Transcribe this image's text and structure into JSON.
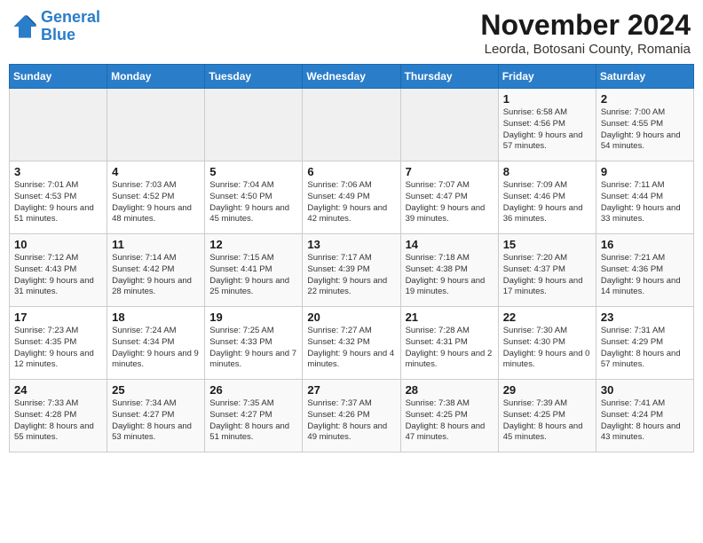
{
  "header": {
    "logo_line1": "General",
    "logo_line2": "Blue",
    "month_title": "November 2024",
    "location": "Leorda, Botosani County, Romania"
  },
  "days_of_week": [
    "Sunday",
    "Monday",
    "Tuesday",
    "Wednesday",
    "Thursday",
    "Friday",
    "Saturday"
  ],
  "weeks": [
    [
      {
        "day": "",
        "info": ""
      },
      {
        "day": "",
        "info": ""
      },
      {
        "day": "",
        "info": ""
      },
      {
        "day": "",
        "info": ""
      },
      {
        "day": "",
        "info": ""
      },
      {
        "day": "1",
        "info": "Sunrise: 6:58 AM\nSunset: 4:56 PM\nDaylight: 9 hours and 57 minutes."
      },
      {
        "day": "2",
        "info": "Sunrise: 7:00 AM\nSunset: 4:55 PM\nDaylight: 9 hours and 54 minutes."
      }
    ],
    [
      {
        "day": "3",
        "info": "Sunrise: 7:01 AM\nSunset: 4:53 PM\nDaylight: 9 hours and 51 minutes."
      },
      {
        "day": "4",
        "info": "Sunrise: 7:03 AM\nSunset: 4:52 PM\nDaylight: 9 hours and 48 minutes."
      },
      {
        "day": "5",
        "info": "Sunrise: 7:04 AM\nSunset: 4:50 PM\nDaylight: 9 hours and 45 minutes."
      },
      {
        "day": "6",
        "info": "Sunrise: 7:06 AM\nSunset: 4:49 PM\nDaylight: 9 hours and 42 minutes."
      },
      {
        "day": "7",
        "info": "Sunrise: 7:07 AM\nSunset: 4:47 PM\nDaylight: 9 hours and 39 minutes."
      },
      {
        "day": "8",
        "info": "Sunrise: 7:09 AM\nSunset: 4:46 PM\nDaylight: 9 hours and 36 minutes."
      },
      {
        "day": "9",
        "info": "Sunrise: 7:11 AM\nSunset: 4:44 PM\nDaylight: 9 hours and 33 minutes."
      }
    ],
    [
      {
        "day": "10",
        "info": "Sunrise: 7:12 AM\nSunset: 4:43 PM\nDaylight: 9 hours and 31 minutes."
      },
      {
        "day": "11",
        "info": "Sunrise: 7:14 AM\nSunset: 4:42 PM\nDaylight: 9 hours and 28 minutes."
      },
      {
        "day": "12",
        "info": "Sunrise: 7:15 AM\nSunset: 4:41 PM\nDaylight: 9 hours and 25 minutes."
      },
      {
        "day": "13",
        "info": "Sunrise: 7:17 AM\nSunset: 4:39 PM\nDaylight: 9 hours and 22 minutes."
      },
      {
        "day": "14",
        "info": "Sunrise: 7:18 AM\nSunset: 4:38 PM\nDaylight: 9 hours and 19 minutes."
      },
      {
        "day": "15",
        "info": "Sunrise: 7:20 AM\nSunset: 4:37 PM\nDaylight: 9 hours and 17 minutes."
      },
      {
        "day": "16",
        "info": "Sunrise: 7:21 AM\nSunset: 4:36 PM\nDaylight: 9 hours and 14 minutes."
      }
    ],
    [
      {
        "day": "17",
        "info": "Sunrise: 7:23 AM\nSunset: 4:35 PM\nDaylight: 9 hours and 12 minutes."
      },
      {
        "day": "18",
        "info": "Sunrise: 7:24 AM\nSunset: 4:34 PM\nDaylight: 9 hours and 9 minutes."
      },
      {
        "day": "19",
        "info": "Sunrise: 7:25 AM\nSunset: 4:33 PM\nDaylight: 9 hours and 7 minutes."
      },
      {
        "day": "20",
        "info": "Sunrise: 7:27 AM\nSunset: 4:32 PM\nDaylight: 9 hours and 4 minutes."
      },
      {
        "day": "21",
        "info": "Sunrise: 7:28 AM\nSunset: 4:31 PM\nDaylight: 9 hours and 2 minutes."
      },
      {
        "day": "22",
        "info": "Sunrise: 7:30 AM\nSunset: 4:30 PM\nDaylight: 9 hours and 0 minutes."
      },
      {
        "day": "23",
        "info": "Sunrise: 7:31 AM\nSunset: 4:29 PM\nDaylight: 8 hours and 57 minutes."
      }
    ],
    [
      {
        "day": "24",
        "info": "Sunrise: 7:33 AM\nSunset: 4:28 PM\nDaylight: 8 hours and 55 minutes."
      },
      {
        "day": "25",
        "info": "Sunrise: 7:34 AM\nSunset: 4:27 PM\nDaylight: 8 hours and 53 minutes."
      },
      {
        "day": "26",
        "info": "Sunrise: 7:35 AM\nSunset: 4:27 PM\nDaylight: 8 hours and 51 minutes."
      },
      {
        "day": "27",
        "info": "Sunrise: 7:37 AM\nSunset: 4:26 PM\nDaylight: 8 hours and 49 minutes."
      },
      {
        "day": "28",
        "info": "Sunrise: 7:38 AM\nSunset: 4:25 PM\nDaylight: 8 hours and 47 minutes."
      },
      {
        "day": "29",
        "info": "Sunrise: 7:39 AM\nSunset: 4:25 PM\nDaylight: 8 hours and 45 minutes."
      },
      {
        "day": "30",
        "info": "Sunrise: 7:41 AM\nSunset: 4:24 PM\nDaylight: 8 hours and 43 minutes."
      }
    ]
  ]
}
